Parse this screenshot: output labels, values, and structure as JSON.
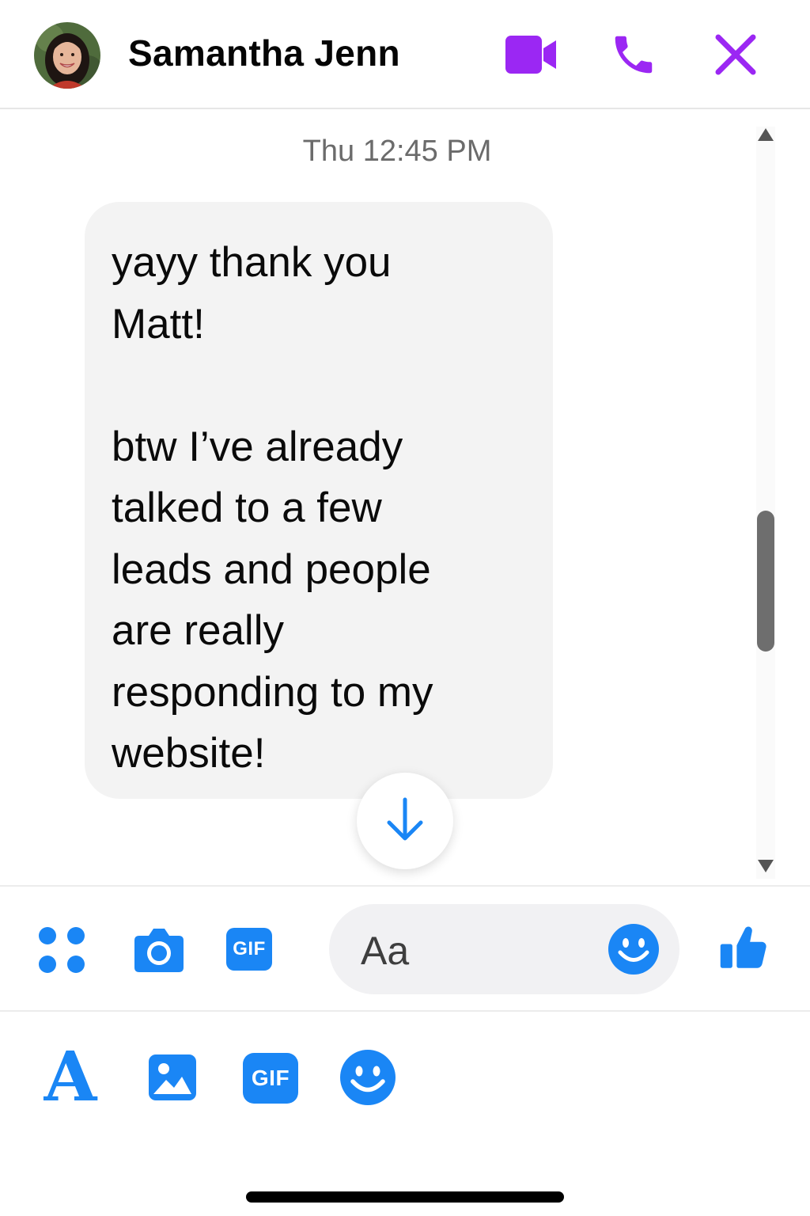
{
  "header": {
    "contact_name": "Samantha Jenn",
    "avatar_icon": "avatar-photo",
    "buttons": [
      {
        "icon": "video-camera-icon",
        "color": "#9b27f3"
      },
      {
        "icon": "phone-icon",
        "color": "#9b27f3"
      },
      {
        "icon": "close-icon",
        "color": "#9b27f3"
      }
    ]
  },
  "conversation": {
    "timestamp": "Thu 12:45 PM",
    "messages": [
      {
        "sender": "Samantha Jenn",
        "direction": "incoming",
        "text": "yayy thank you\nMatt!\n\nbtw I’ve already\ntalked to a few\nleads and people\nare really\nresponding to my\nwebsite!"
      }
    ],
    "jump_to_latest_icon": "arrow-down-icon"
  },
  "composer": {
    "placeholder": "Aa",
    "accent_color": "#1a86f5",
    "icons": [
      "apps-grid-icon",
      "camera-icon",
      "gif-icon",
      "emoji-icon",
      "thumbs-up-icon"
    ],
    "gif_label": "GIF"
  },
  "toolbar": {
    "icons": [
      "text-format-icon",
      "image-icon",
      "gif-icon",
      "emoji-icon"
    ],
    "font_label": "A",
    "gif_label": "GIF"
  }
}
